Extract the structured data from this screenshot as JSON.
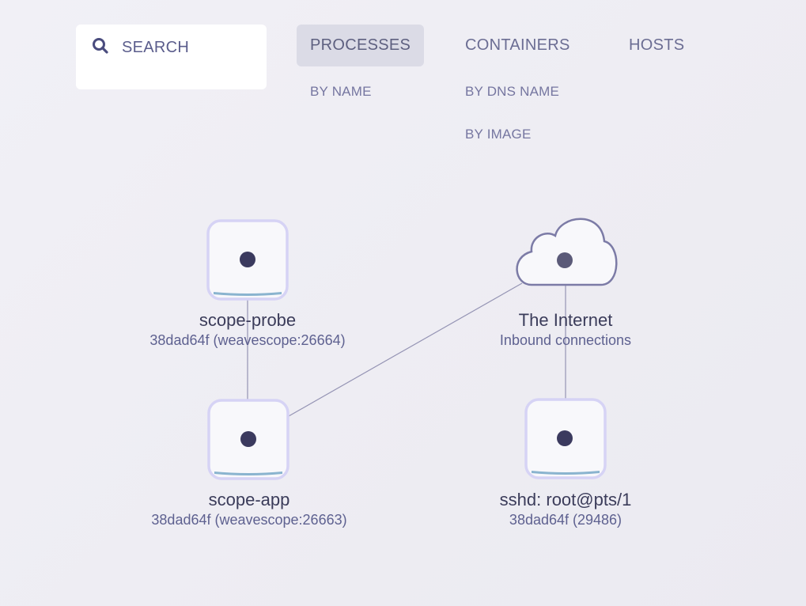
{
  "search": {
    "icon": "search-icon",
    "label": "SEARCH"
  },
  "topologies": [
    {
      "label": "PROCESSES",
      "active": true,
      "sub": [
        "BY NAME"
      ]
    },
    {
      "label": "CONTAINERS",
      "active": false,
      "sub": [
        "BY DNS NAME",
        "BY IMAGE"
      ]
    },
    {
      "label": "HOSTS",
      "active": false,
      "sub": []
    }
  ],
  "colors": {
    "node_border": "#d6d3f5",
    "node_fill": "#f8f8fb",
    "node_dot": "#3b3a5e",
    "metric_bar": "#8ab4cf",
    "edge": "#9594b4",
    "cloud_stroke": "#7c7ba6"
  },
  "nodes": [
    {
      "id": "scope-probe",
      "shape": "square",
      "title": "scope-probe",
      "subtitle": "38dad64f (weavescope:26664)"
    },
    {
      "id": "the-internet",
      "shape": "cloud",
      "title": "The Internet",
      "subtitle": "Inbound connections"
    },
    {
      "id": "scope-app",
      "shape": "square",
      "title": "scope-app",
      "subtitle": "38dad64f (weavescope:26663)"
    },
    {
      "id": "sshd",
      "shape": "square",
      "title": "sshd: root@pts/1",
      "subtitle": "38dad64f (29486)"
    }
  ],
  "edges": [
    {
      "from": "scope-probe",
      "to": "scope-app"
    },
    {
      "from": "the-internet",
      "to": "scope-app"
    },
    {
      "from": "the-internet",
      "to": "sshd"
    }
  ]
}
